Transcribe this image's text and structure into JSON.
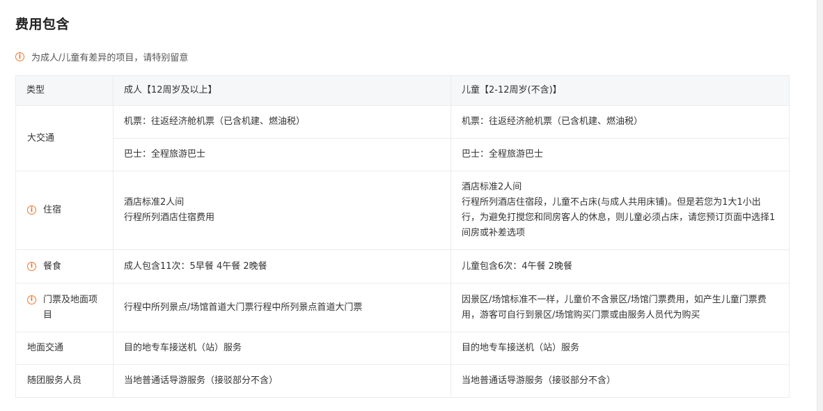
{
  "title": "费用包含",
  "notice": {
    "icon": "info-circle-icon",
    "text": "为成人/儿童有差异的项目，请特别留意"
  },
  "table": {
    "headers": {
      "type": "类型",
      "adult": "成人【12周岁及以上】",
      "child": "儿童【2-12周岁(不含)】"
    },
    "transport": {
      "label": "大交通",
      "flight_adult": "机票：往返经济舱机票（已含机建、燃油税）",
      "flight_child": "机票：往返经济舱机票（已含机建、燃油税）",
      "bus_adult": "巴士：全程旅游巴士",
      "bus_child": "巴士：全程旅游巴士"
    },
    "hotel": {
      "label": "住宿",
      "adult_line1": "酒店标准2人间",
      "adult_line2": "行程所列酒店住宿费用",
      "child_line1": "酒店标准2人间",
      "child_line2": "行程所列酒店住宿段，儿童不占床(与成人共用床铺)。但是若您为1大1小出行，为避免打搅您和同房客人的休息，则儿童必须占床，请您预订页面中选择1间房或补差选项"
    },
    "meals": {
      "label": "餐食",
      "adult": "成人包含11次：5早餐 4午餐 2晚餐",
      "child": "儿童包含6次：4午餐 2晚餐"
    },
    "tickets": {
      "label": "门票及地面项目",
      "adult": "行程中所列景点/场馆首道大门票行程中所列景点首道大门票",
      "child": "因景区/场馆标准不一样，儿童价不含景区/场馆门票费用，如产生儿童门票费用，游客可自行到景区/场馆购买门票或由服务人员代为购买"
    },
    "ground": {
      "label": "地面交通",
      "adult": "目的地专车接送机（站）服务",
      "child": "目的地专车接送机（站）服务"
    },
    "guide": {
      "label": "随团服务人员",
      "adult": "当地普通话导游服务（接驳部分不含）",
      "child": "当地普通话导游服务（接驳部分不含）"
    }
  },
  "colors": {
    "accent": "#f0742b",
    "header_bg": "#f6f7f9",
    "border": "#ececec"
  }
}
